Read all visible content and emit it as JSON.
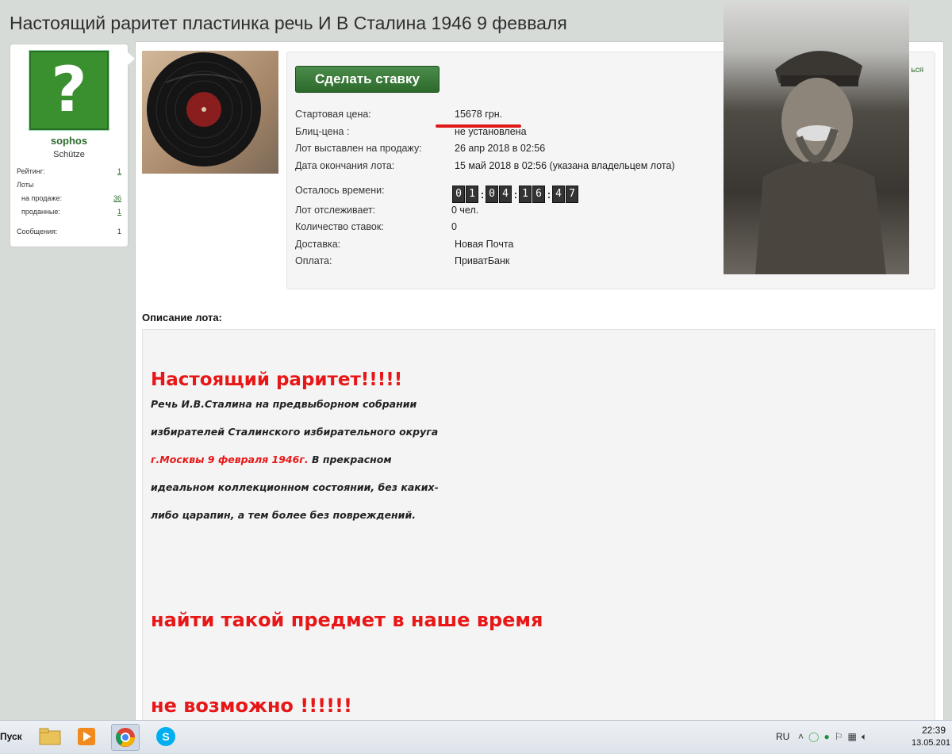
{
  "page": {
    "title": "Настоящий раритет пластинка речь И В Сталина 1946 9 февваля"
  },
  "user": {
    "avatar_char": "?",
    "name": "sophos",
    "title": "Schütze",
    "rating_label": "Рейтинг:",
    "rating_value": "1",
    "lots_label": "Лоты",
    "on_sale_label": "на продаже:",
    "on_sale_value": "36",
    "sold_label": "проданные:",
    "sold_value": "1",
    "messages_label": "Сообщения:",
    "messages_value": "1"
  },
  "lot": {
    "bid_button": "Сделать ставку",
    "partial_link": "ься",
    "rows": [
      {
        "label": "Стартовая цена:",
        "value": "15678 грн."
      },
      {
        "label": "Блиц-цена :",
        "value": "не установлена"
      },
      {
        "label": "Лот выставлен на продажу:",
        "value": "26 апр 2018 в 02:56"
      },
      {
        "label": "Дата окончания лота:",
        "value": "15 май 2018 в 02:56 (указана владельцем лота)"
      },
      {
        "label": "Осталось времени:",
        "value": ""
      },
      {
        "label": "Лот отслеживает:",
        "value": "0 чел."
      },
      {
        "label": "Количество ставок:",
        "value": "0"
      },
      {
        "label": "Доставка:",
        "value": "Новая Почта"
      },
      {
        "label": "Оплата:",
        "value": "ПриватБанк"
      }
    ],
    "timer": [
      "0",
      "1",
      "0",
      "4",
      "1",
      "6",
      "4",
      "7"
    ]
  },
  "description": {
    "heading": "Описание лота:",
    "big1": "Настоящий раритет!!!!!",
    "line1": "Речь И.В.Сталина на предвыборном собрании",
    "line2": "избирателей Сталинского избирательного округа",
    "line3_red": "г.Москвы 9 февраля 1946г.",
    "line3_rest": " В прекрасном",
    "line4": "идеальном коллекционном состоянии, без каких-",
    "line5": "либо царапин, а тем более без повреждений.",
    "big2": "найти такой предмет в наше время",
    "big3": "не возможно !!!!!!"
  },
  "taskbar": {
    "start": "Пуск",
    "lang": "RU",
    "time": "22:39",
    "date": "13.05.201"
  },
  "colors": {
    "accent_green": "#2d6a2d",
    "highlight_red": "#e81717"
  }
}
